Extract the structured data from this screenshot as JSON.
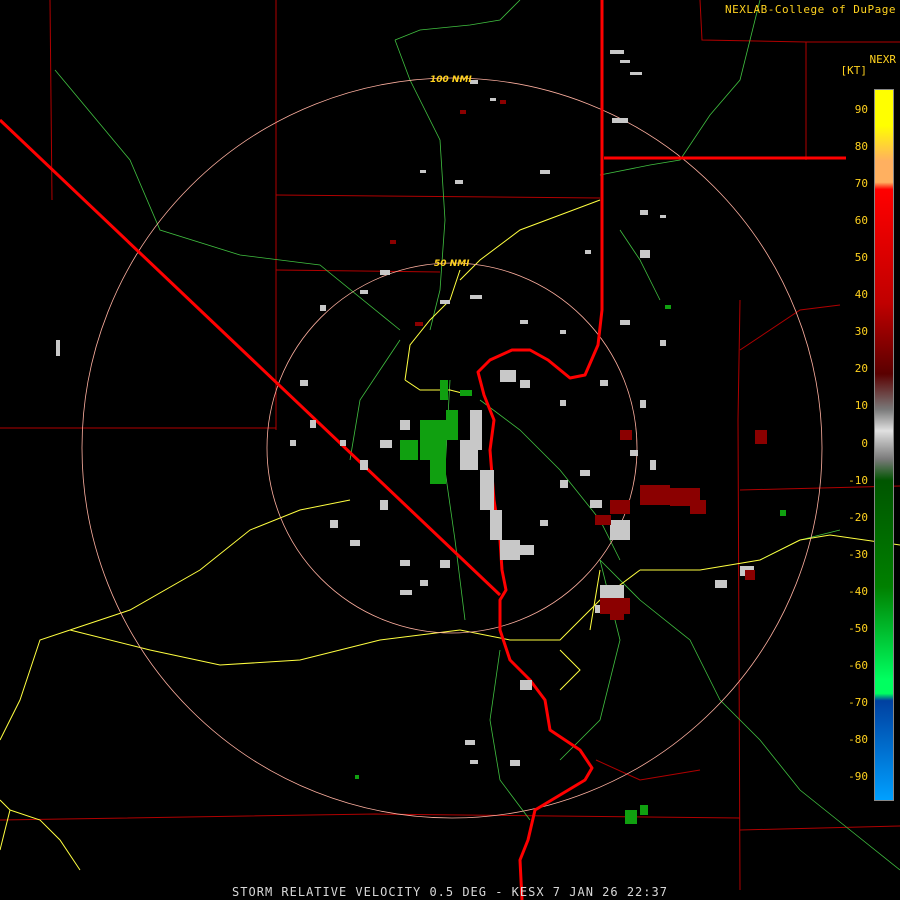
{
  "credit": "NEXLAB-College of DuPage",
  "product_footer": "STORM RELATIVE VELOCITY 0.5 DEG - KESX 7 JAN 26 22:37",
  "legend": {
    "product": "NEXR",
    "unit": "[KT]",
    "ticks": [
      "90",
      "80",
      "70",
      "60",
      "50",
      "40",
      "30",
      "20",
      "10",
      "0",
      "-10",
      "-20",
      "-30",
      "-40",
      "-50",
      "-60",
      "-70",
      "-80",
      "-90"
    ],
    "colors": {
      "ninety": "#ffff00",
      "eighty": "#ffb060",
      "seventy": "#ff0000",
      "high_red": "#c00000",
      "dark_red": "#5a0000",
      "zero_light": "#e0e0e0",
      "zero_gray": "#7a7a7a",
      "dark_green": "#005500",
      "mid_green": "#008000",
      "bright_green": "#00ff60",
      "dark_blue": "#0040a0",
      "light_blue": "#00a0ff"
    }
  },
  "range_rings": {
    "outer_label": "100 NMI",
    "inner_label": "50 NMI"
  },
  "map_colors": {
    "state_border": "#ff0000",
    "county_line": "#b00000",
    "highway": "#ffff40",
    "road": "#40c040",
    "ring": "#ffb0a0",
    "echo_gray": "#c8c8c8",
    "echo_red": "#8b0000",
    "echo_green": "#10a010"
  }
}
